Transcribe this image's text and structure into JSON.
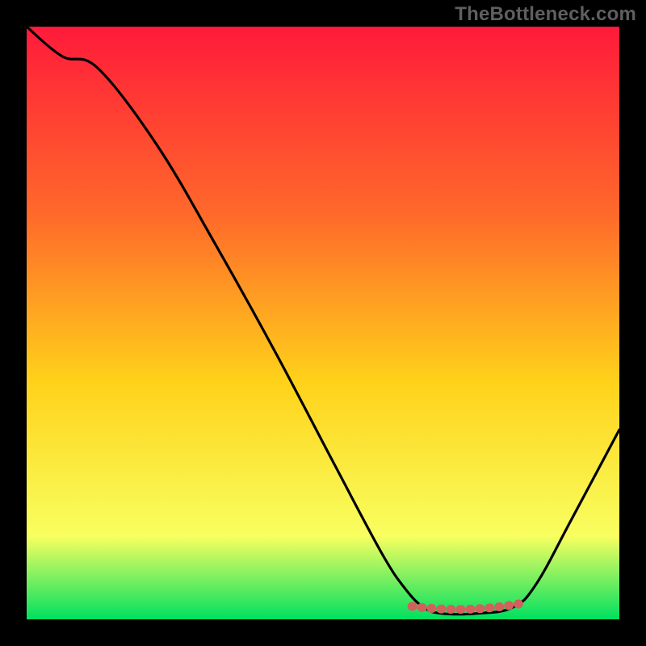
{
  "watermark": "TheBottleneck.com",
  "colors": {
    "background": "#000000",
    "gradient_top": "#ff1a3a",
    "gradient_mid_top": "#ff6a2a",
    "gradient_mid": "#ffd21a",
    "gradient_mid_bottom": "#f8ff60",
    "gradient_bottom": "#00e060",
    "curve": "#000000",
    "marker": "#d1615d"
  },
  "chart_data": {
    "type": "line",
    "title": "",
    "xlabel": "",
    "ylabel": "",
    "xrange": [
      0,
      100
    ],
    "yrange": [
      0,
      100
    ],
    "series": [
      {
        "name": "curve",
        "points": [
          {
            "x": 0,
            "y": 100
          },
          {
            "x": 6,
            "y": 95
          },
          {
            "x": 12,
            "y": 93
          },
          {
            "x": 22,
            "y": 80
          },
          {
            "x": 32,
            "y": 63
          },
          {
            "x": 42,
            "y": 45
          },
          {
            "x": 52,
            "y": 26
          },
          {
            "x": 60,
            "y": 11
          },
          {
            "x": 64,
            "y": 5
          },
          {
            "x": 67,
            "y": 2
          },
          {
            "x": 70,
            "y": 1
          },
          {
            "x": 76,
            "y": 1
          },
          {
            "x": 82,
            "y": 2
          },
          {
            "x": 86,
            "y": 6
          },
          {
            "x": 92,
            "y": 17
          },
          {
            "x": 100,
            "y": 32
          }
        ]
      }
    ],
    "marker_band": {
      "name": "optimal-range",
      "x_start": 65,
      "x_end": 83,
      "y": 1
    }
  }
}
